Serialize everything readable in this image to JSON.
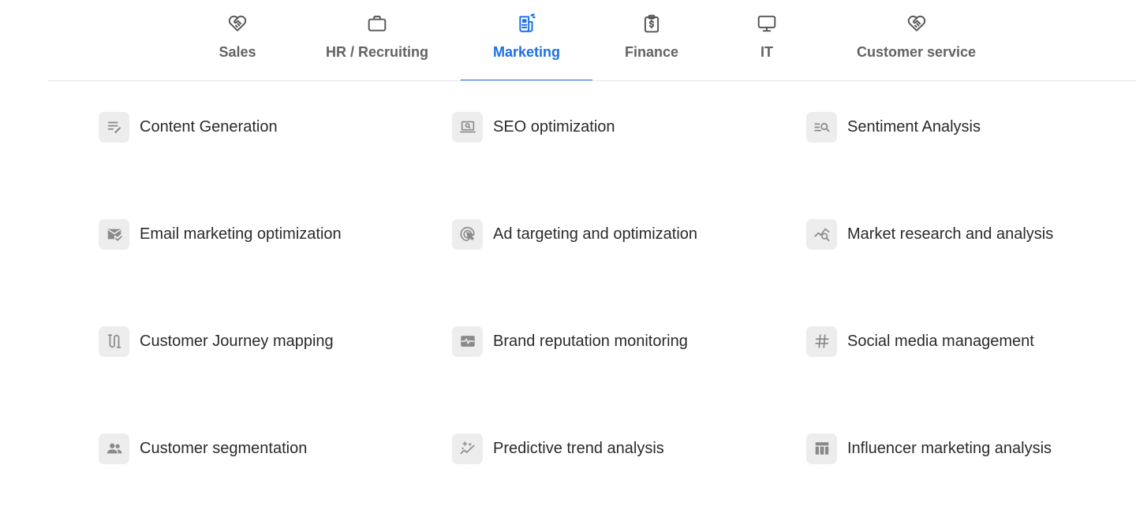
{
  "accent_color": "#1a6fe6",
  "tabs": [
    {
      "label": "Sales",
      "icon": "handshake-icon",
      "active": false
    },
    {
      "label": "HR / Recruiting",
      "icon": "briefcase-icon",
      "active": false
    },
    {
      "label": "Marketing",
      "icon": "newspaper-icon",
      "active": true
    },
    {
      "label": "Finance",
      "icon": "clipboard-dollar-icon",
      "active": false
    },
    {
      "label": "IT",
      "icon": "monitor-icon",
      "active": false
    },
    {
      "label": "Customer service",
      "icon": "handshake-icon",
      "active": false
    }
  ],
  "items": [
    {
      "label": "Content Generation",
      "icon": "edit-notes-icon"
    },
    {
      "label": "SEO optimization",
      "icon": "laptop-search-icon"
    },
    {
      "label": "Sentiment Analysis",
      "icon": "manage-search-icon"
    },
    {
      "label": "Email marketing optimization",
      "icon": "mark-email-read-icon"
    },
    {
      "label": "Ad targeting and optimization",
      "icon": "ads-click-icon"
    },
    {
      "label": "Market research and analysis",
      "icon": "query-stats-icon"
    },
    {
      "label": "Customer Journey mapping",
      "icon": "route-icon"
    },
    {
      "label": "Brand reputation monitoring",
      "icon": "monitor-heart-icon"
    },
    {
      "label": "Social media management",
      "icon": "hashtag-icon"
    },
    {
      "label": "Customer segmentation",
      "icon": "group-icon"
    },
    {
      "label": "Predictive trend analysis",
      "icon": "sparkle-trend-icon"
    },
    {
      "label": "Influencer marketing analysis",
      "icon": "table-chart-icon"
    }
  ]
}
